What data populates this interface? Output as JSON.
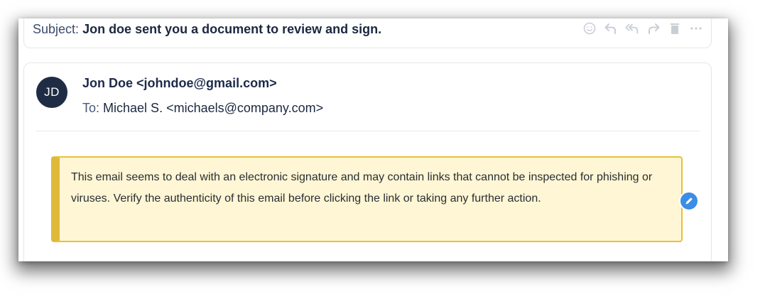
{
  "subject": {
    "label": "Subject:",
    "value": "Jon doe sent you a document to review and sign."
  },
  "toolbar": {
    "icons": [
      "emoji-icon",
      "reply-icon",
      "reply-all-icon",
      "forward-icon",
      "trash-icon",
      "more-icon"
    ],
    "icon_color": "#c9ced6"
  },
  "message": {
    "avatar_initials": "JD",
    "avatar_color": "#1f2d44",
    "from": "Jon Doe <johndoe@gmail.com>",
    "to_label": "To:",
    "to": "Michael S. <michaels@company.com>"
  },
  "warning": {
    "text": "This email seems to deal with an electronic signature and may contain links that cannot be inspected for phishing or viruses. Verify the authenticity of this email before clicking the link or taking any further action.",
    "background_color": "#fef6d4",
    "border_color": "#e0b93a"
  },
  "edit_badge": {
    "icon": "pencil-icon",
    "color": "#3b8de6"
  }
}
